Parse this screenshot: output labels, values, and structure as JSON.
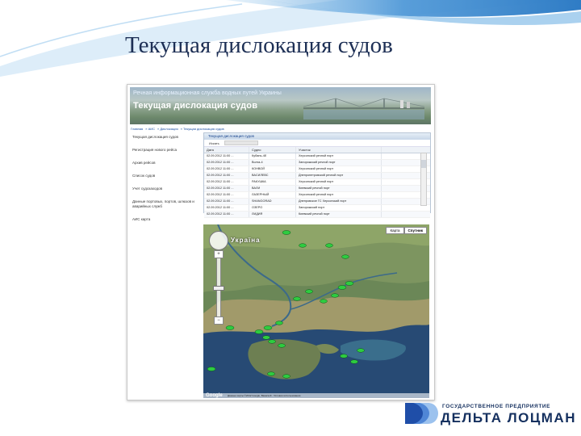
{
  "slide_title": "Текущая дислокация судов",
  "banner": {
    "subtitle": "Речная информационная служба водных путей Украины",
    "title": "Текущая дислокация судов"
  },
  "breadcrumb": [
    "Главная",
    "АИС",
    "Дислокация",
    "Текущая дислокация судов"
  ],
  "sidebar": {
    "items": [
      {
        "label": "Текущая дислокация судов"
      },
      {
        "label": "Регистрация нового рейса"
      },
      {
        "label": "Архив рейсов"
      },
      {
        "label": "Список судов"
      },
      {
        "label": "Учет судозаходов"
      },
      {
        "label": "Данные портовых, портов, шлюзов и аварийных служб"
      },
      {
        "label": "АИС карта"
      }
    ]
  },
  "panel": {
    "title": "Текущая дислокация судов",
    "tool_label": "Искать",
    "columns": [
      "Дата",
      "Судно",
      "Участок"
    ],
    "rows": [
      {
        "date": "02.09.2012 11:00 ...",
        "vessel": "Кубань-4б",
        "place": "Херсонский речной порт"
      },
      {
        "date": "02.09.2012 11:00 ...",
        "vessel": "Волга-4",
        "place": "Запорожский речной порт"
      },
      {
        "date": "02.09.2012 11:00 ...",
        "vessel": "КОНВОЙ",
        "place": "Херсонский речной порт"
      },
      {
        "date": "02.09.2012 11:00 ...",
        "vessel": "ВАСИЛЕВС",
        "place": "Днепропетровский речной порт"
      },
      {
        "date": "02.09.2012 11:00 ...",
        "vessel": "РАКУШКА",
        "place": "Херсонский речной порт"
      },
      {
        "date": "02.09.2012 11:00 ...",
        "vessel": "ВАЛИ",
        "place": "Киевский речной порт"
      },
      {
        "date": "02.09.2012 11:00 ...",
        "vessel": "ЛАЗЕРНЫЙ",
        "place": "Херсонский речной порт"
      },
      {
        "date": "02.09.2012 11:00 ...",
        "vessel": "SHANGORAD",
        "place": "Днепровское ГС Херсонский порт"
      },
      {
        "date": "02.09.2012 11:00 ...",
        "vessel": "ОЗЕРО",
        "place": "Запорожский порт"
      },
      {
        "date": "02.09.2012 11:00 ...",
        "vessel": "ЛИДИЯ",
        "place": "Киевский речной порт"
      }
    ]
  },
  "map": {
    "country_label": "Україна",
    "btn_map": "Карта",
    "btn_satellite": "Спутник",
    "footer": "Данные карты ©2012 Google, Basarsoft - Условия использования",
    "google_label": "Google"
  },
  "logo": {
    "small": "ГОСУДАРСТВЕННОЕ ПРЕДПРИЯТИЕ",
    "big": "ДЕЛЬТА ЛОЦМАН"
  },
  "colors": {
    "title": "#1d2f55",
    "logo": "#15305f",
    "ship_marker": "#2ecc40",
    "accent_blue": "#1a4fa3"
  }
}
